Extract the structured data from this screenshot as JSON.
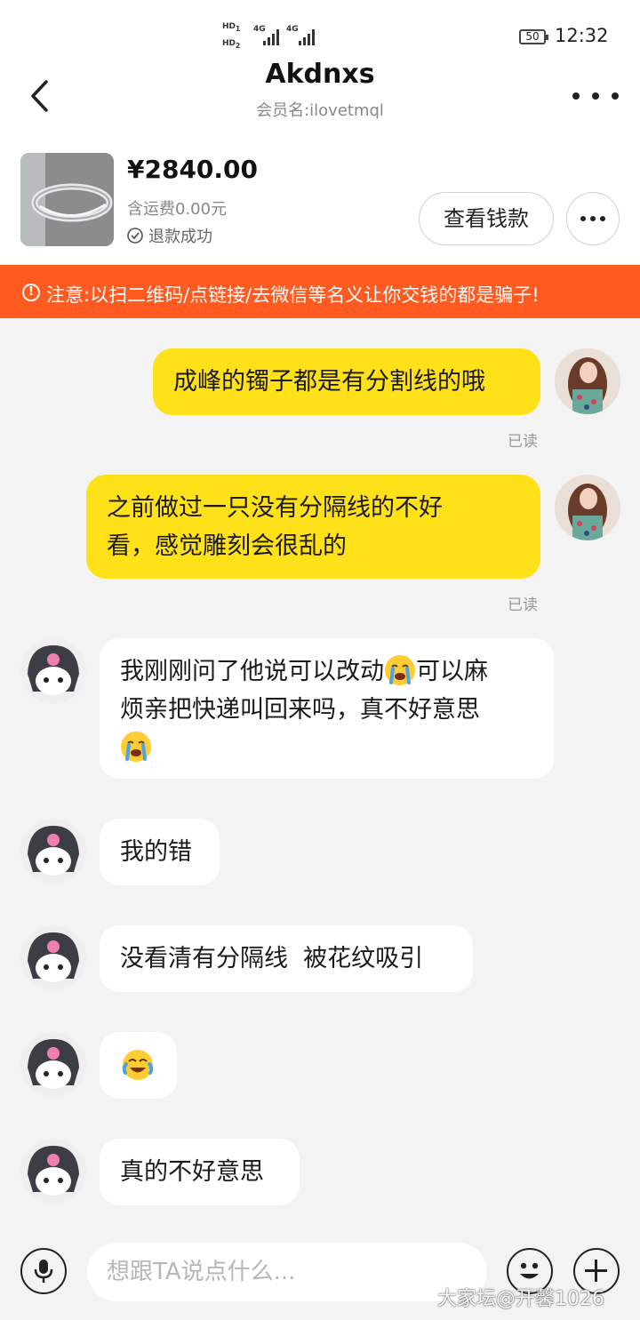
{
  "status_bar": {
    "hd1": "HD",
    "hd2": "HD",
    "net1": "4G",
    "net2": "4G",
    "battery": "50",
    "time": "12:32"
  },
  "header": {
    "title": "Akdnxs",
    "member_label": "会员名:",
    "member_name": "ilovetmql",
    "back_icon": "chevron-left-icon",
    "more_icon": "more-horizontal-icon"
  },
  "order": {
    "price": "¥2840.00",
    "shipping": "含运费0.00元",
    "status": "退款成功",
    "view_money_label": "查看钱款"
  },
  "warning": {
    "text": "注意:以扫二维码/点链接/去微信等名义让你交钱的都是骗子!",
    "color": "#ff5a1f"
  },
  "messages": [
    {
      "from": "me",
      "text": "成峰的镯子都是有分割线的哦",
      "read": "已读"
    },
    {
      "from": "me",
      "line1": "之前做过一只没有分隔线的不好",
      "line2": "看，感觉雕刻会很乱的",
      "read": "已读"
    },
    {
      "from": "them",
      "line1a": "我刚刚问了他说可以改动",
      "line1b": "可以麻",
      "line2": "烦亲把快递叫回来吗，真不好意思"
    },
    {
      "from": "them",
      "text": "我的错"
    },
    {
      "from": "them",
      "text": "没看清有分隔线  被花纹吸引"
    },
    {
      "from": "them",
      "text": ""
    },
    {
      "from": "them",
      "text": "真的不好意思"
    }
  ],
  "input": {
    "placeholder": "想跟TA说点什么..."
  },
  "watermark": "大家坛@开馨1026",
  "colors": {
    "accent": "#ffe11a",
    "warning": "#ff5a1f"
  }
}
